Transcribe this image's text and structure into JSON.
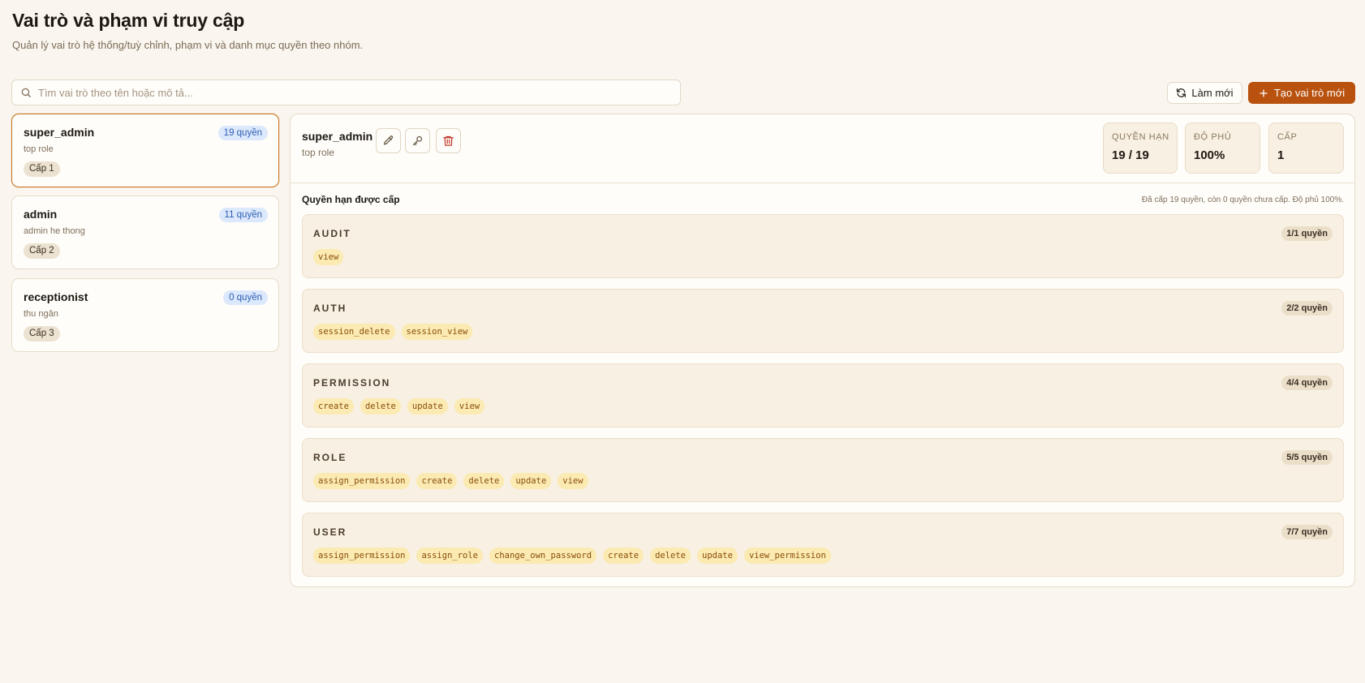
{
  "page": {
    "title": "Vai trò và phạm vi truy cập",
    "subtitle": "Quản lý vai trò hệ thống/tuỳ chỉnh, phạm vi và danh mục quyền theo nhóm."
  },
  "search": {
    "placeholder": "Tìm vai trò theo tên hoặc mô tả..."
  },
  "toolbar": {
    "refresh_label": "Làm mới",
    "create_label": "Tạo vai trò mới"
  },
  "roles": [
    {
      "name": "super_admin",
      "description": "top role",
      "count": "19 quyền",
      "level": "Cấp 1"
    },
    {
      "name": "admin",
      "description": "admin he thong",
      "count": "11 quyền",
      "level": "Cấp 2"
    },
    {
      "name": "receptionist",
      "description": "thu ngân",
      "count": "0 quyền",
      "level": "Cấp 3"
    }
  ],
  "detail": {
    "name": "super_admin",
    "description": "top role",
    "stats": [
      {
        "label": "Quyền hạn",
        "value": "19 / 19"
      },
      {
        "label": "Độ phủ",
        "value": "100%"
      },
      {
        "label": "Cấp",
        "value": "1"
      }
    ],
    "permissions_title": "Quyền hạn được cấp",
    "permissions_summary": "Đã cấp 19 quyền, còn 0 quyền chưa cấp. Độ phủ 100%.",
    "groups": [
      {
        "name": "AUDIT",
        "count": "1/1 quyền",
        "perms": [
          "view"
        ]
      },
      {
        "name": "AUTH",
        "count": "2/2 quyền",
        "perms": [
          "session_delete",
          "session_view"
        ]
      },
      {
        "name": "PERMISSION",
        "count": "4/4 quyền",
        "perms": [
          "create",
          "delete",
          "update",
          "view"
        ]
      },
      {
        "name": "ROLE",
        "count": "5/5 quyền",
        "perms": [
          "assign_permission",
          "create",
          "delete",
          "update",
          "view"
        ]
      },
      {
        "name": "USER",
        "count": "7/7 quyền",
        "perms": [
          "assign_permission",
          "assign_role",
          "change_own_password",
          "create",
          "delete",
          "update",
          "view_permission"
        ]
      }
    ]
  },
  "icons": {
    "search": "search-icon",
    "refresh": "refresh-icon",
    "plus": "plus-icon",
    "edit": "pencil-icon",
    "permissions": "key-icon",
    "delete": "trash-icon"
  },
  "colors": {
    "background": "#faf6ef",
    "accent": "#b8520e",
    "active_border": "#c5731f",
    "count_badge_bg": "#dce8fb",
    "count_badge_text": "#2f5fb5",
    "perm_chip_bg": "#fbeab2",
    "perm_chip_text": "#8a4e0a",
    "danger": "#c0392b"
  }
}
